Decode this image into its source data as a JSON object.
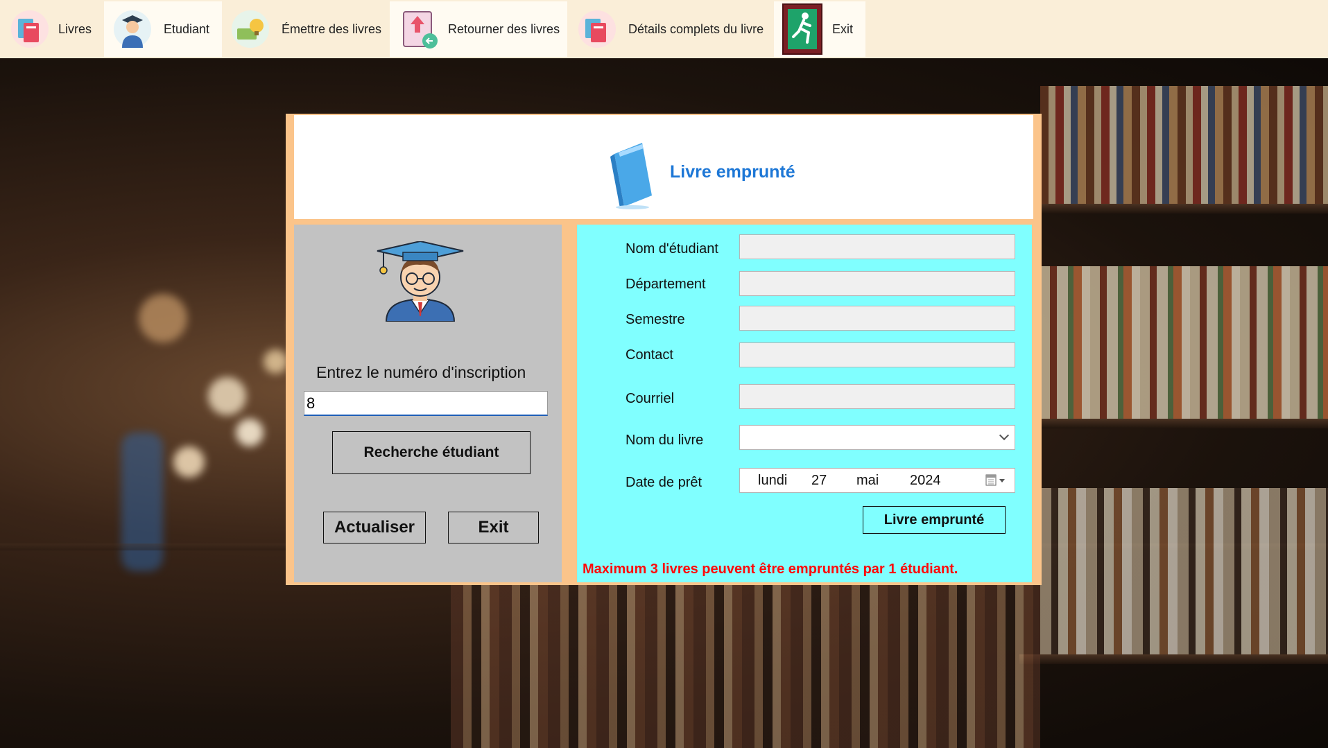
{
  "menu": {
    "items": [
      {
        "label": "Livres",
        "icon": "books-icon"
      },
      {
        "label": "Etudiant",
        "icon": "student-icon"
      },
      {
        "label": "Émettre des livres",
        "icon": "issue-books-icon"
      },
      {
        "label": "Retourner des livres",
        "icon": "return-books-icon"
      },
      {
        "label": "Détails complets du livre",
        "icon": "book-details-icon"
      },
      {
        "label": "Exit",
        "icon": "exit-running-man-icon"
      }
    ],
    "active_index": 1
  },
  "dialog": {
    "title": "Livre emprunté",
    "title_icon": "blue-book-icon",
    "title_color": "#1d77d6",
    "border_color": "#fbc48a",
    "left": {
      "avatar_icon": "graduate-student-icon",
      "prompt": "Entrez le numéro d'inscription",
      "registration_value": "8",
      "search_button": "Recherche étudiant",
      "refresh_button": "Actualiser",
      "exit_button": "Exit"
    },
    "right": {
      "labels": {
        "student_name": "Nom d'étudiant",
        "department": "Département",
        "semester": "Semestre",
        "contact": "Contact",
        "email": "Courriel",
        "book_name": "Nom du livre",
        "loan_date": "Date de prêt"
      },
      "values": {
        "student_name": "",
        "department": "",
        "semester": "",
        "contact": "",
        "email": "",
        "book_name": ""
      },
      "date": {
        "weekday": "lundi",
        "day": "27",
        "month": "mai",
        "year": "2024"
      },
      "borrow_button": "Livre emprunté",
      "warning": "Maximum 3 livres peuvent être empruntés par 1 étudiant.",
      "warning_color": "#ff0a0a",
      "panel_color": "#80ffff"
    }
  }
}
